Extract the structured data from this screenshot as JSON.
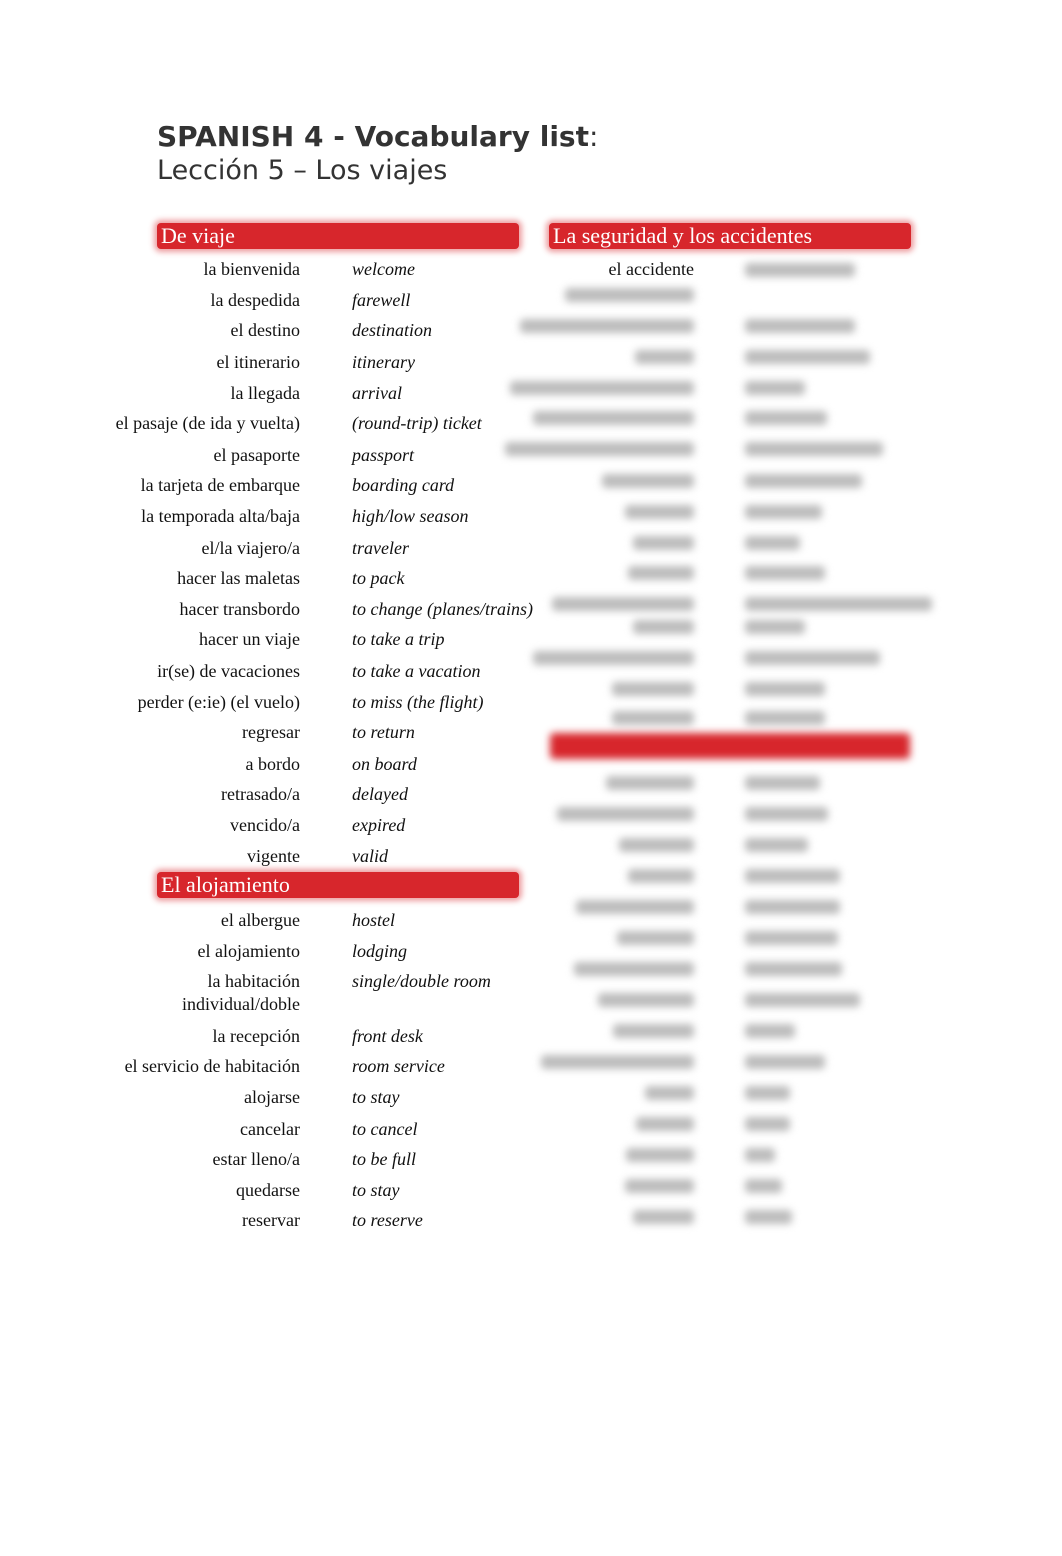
{
  "title": "SPANISH 4 - Vocabulary list",
  "title_colon": ":",
  "subtitle": "Lección 5 – Los viajes",
  "accent_color": "#d7262c",
  "sections": {
    "de_viaje": {
      "heading": "De viaje",
      "items": [
        {
          "es": "la bienvenida",
          "en": "welcome"
        },
        {
          "es": "la despedida",
          "en": "farewell"
        },
        {
          "es": "el destino",
          "en": "destination"
        },
        {
          "es": "el itinerario",
          "en": "itinerary"
        },
        {
          "es": "la llegada",
          "en": "arrival"
        },
        {
          "es": "el pasaje (de ida y vuelta)",
          "en": "(round-trip) ticket"
        },
        {
          "es": "el pasaporte",
          "en": "passport"
        },
        {
          "es": "la tarjeta de embarque",
          "en": "boarding card"
        },
        {
          "es": "la temporada alta/baja",
          "en": "high/low season"
        },
        {
          "es": "el/la viajero/a",
          "en": "traveler"
        },
        {
          "es": "hacer las maletas",
          "en": "to pack"
        },
        {
          "es": "hacer transbordo",
          "en": "to change (planes/trains)"
        },
        {
          "es": "hacer un viaje",
          "en": "to take a trip"
        },
        {
          "es": "ir(se) de vacaciones",
          "en": "to take a vacation"
        },
        {
          "es": "perder (e:ie) (el vuelo)",
          "en": "to miss (the flight)"
        },
        {
          "es": "regresar",
          "en": "to return"
        },
        {
          "es": "a bordo",
          "en": "on board"
        },
        {
          "es": "retrasado/a",
          "en": "delayed"
        },
        {
          "es": "vencido/a",
          "en": "expired"
        },
        {
          "es": "vigente",
          "en": "valid"
        }
      ]
    },
    "alojamiento": {
      "heading": "El alojamiento",
      "items": [
        {
          "es": "el albergue",
          "en": "hostel"
        },
        {
          "es": "el alojamiento",
          "en": "lodging"
        },
        {
          "es": "la habitación",
          "es2": "individual/doble",
          "en": "single/double room"
        },
        {
          "es": "la recepción",
          "en": "front desk"
        },
        {
          "es": "el servicio de habitación",
          "en": "room service"
        },
        {
          "es": "alojarse",
          "en": "to stay"
        },
        {
          "es": "cancelar",
          "en": "to cancel"
        },
        {
          "es": "estar lleno/a",
          "en": "to be full"
        },
        {
          "es": "quedarse",
          "en": "to stay"
        },
        {
          "es": "reservar",
          "en": "to reserve"
        }
      ]
    },
    "seguridad": {
      "heading": "La seguridad y los accidentes",
      "first_item": "el accidente"
    }
  }
}
